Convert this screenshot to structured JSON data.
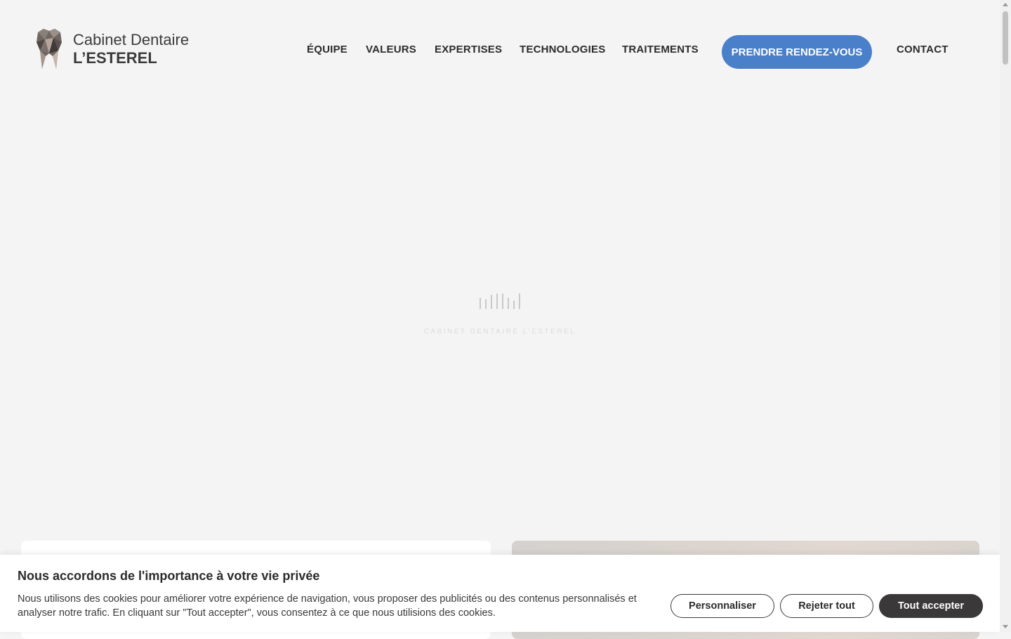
{
  "header": {
    "logo": {
      "line1": "Cabinet Dentaire",
      "line2": "L’ESTEREL",
      "icon": "tooth-icon"
    },
    "nav": [
      {
        "id": "equipe",
        "label": "ÉQUIPE"
      },
      {
        "id": "valeurs",
        "label": "VALEURS"
      },
      {
        "id": "expertises",
        "label": "EXPERTISES"
      },
      {
        "id": "technologies",
        "label": "TECHNOLOGIES"
      },
      {
        "id": "traitements",
        "label": "TRAITEMENTS"
      },
      {
        "id": "contact",
        "label": "CONTACT"
      }
    ],
    "cta_label": "PRENDRE RENDEZ-VOUS"
  },
  "loader": {
    "text": "CABINET DENTAIRE L'ESTEREL"
  },
  "cookie_banner": {
    "title": "Nous accordons de l'importance à votre vie privée",
    "text": "Nous utilisons des cookies pour améliorer votre expérience de navigation, vous proposer des publicités ou des contenus personnalisés et analyser notre trafic. En cliquant sur \"Tout accepter\", vous consentez à ce que nous utilisions des cookies.",
    "buttons": {
      "customize": "Personnaliser",
      "reject": "Rejeter tout",
      "accept": "Tout accepter"
    }
  },
  "colors": {
    "background": "#f4f4f4",
    "cta": "#4a7fc9",
    "accept_button": "#3a3838"
  }
}
